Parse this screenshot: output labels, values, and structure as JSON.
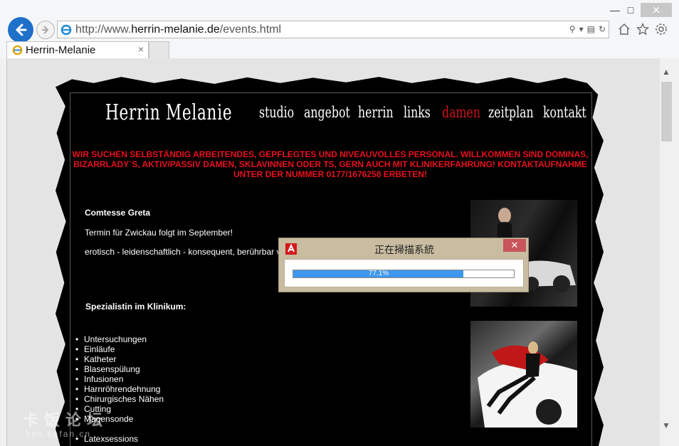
{
  "browser": {
    "url_prefix": "http://www.",
    "url_domain": "herrin-melanie.de",
    "url_path": "/events.html",
    "tab_title": "Herrin-Melanie",
    "tab_close": "×"
  },
  "site": {
    "logo": "Herrin Melanie",
    "nav": [
      {
        "label": "studio"
      },
      {
        "label": "angebot"
      },
      {
        "label": "herrin"
      },
      {
        "label": "links"
      },
      {
        "label": "damen",
        "active": true
      },
      {
        "label": "zeitplan"
      },
      {
        "label": "kontakt"
      }
    ],
    "announcement_line1": "WIR SUCHEN SELBSTÄNDIG ARBEITENDES, GEPFLEGTES UND NIVEAUVOLLES PERSONAL. WILLKOMMEN SIND DOMINAS,",
    "announcement_line2": "BIZARRLADY´S, AKTIV/PASSIV DAMEN, SKLAVINNEN ODER TS, GERN AUCH MIT KLINIKERFAHRUNG! KONTAKTAUFNAHME",
    "announcement_line3": "UNTER DER NUMMER 0177/1676258 ERBETEN!",
    "profile_name": "Comtesse Greta",
    "profile_line1": "Termin für Zwickau folgt im September!",
    "profile_line2": "erotisch - leidenschaftlich - konsequent, berührbar v",
    "specialist_heading": "Spezialistin im Klinikum:",
    "specialties": [
      "Untersuchungen",
      "Einläufe",
      "Katheter",
      "Blasenspülung",
      "Infusionen",
      "Harnröhrendehnung",
      "Chirurgisches Nähen",
      "Cutting",
      "Magensonde",
      "",
      "Latexsessions"
    ]
  },
  "dialog": {
    "title": "正在掃描系統",
    "progress_label": "77.1%",
    "progress": 0.771,
    "close": "✕"
  },
  "watermark": {
    "line1": "卡饭论坛",
    "line2": "bbs.kafan.cn"
  },
  "colors": {
    "nav_active": "#d0141b",
    "announcement": "#e8111c",
    "progress": "#3e97f0"
  }
}
